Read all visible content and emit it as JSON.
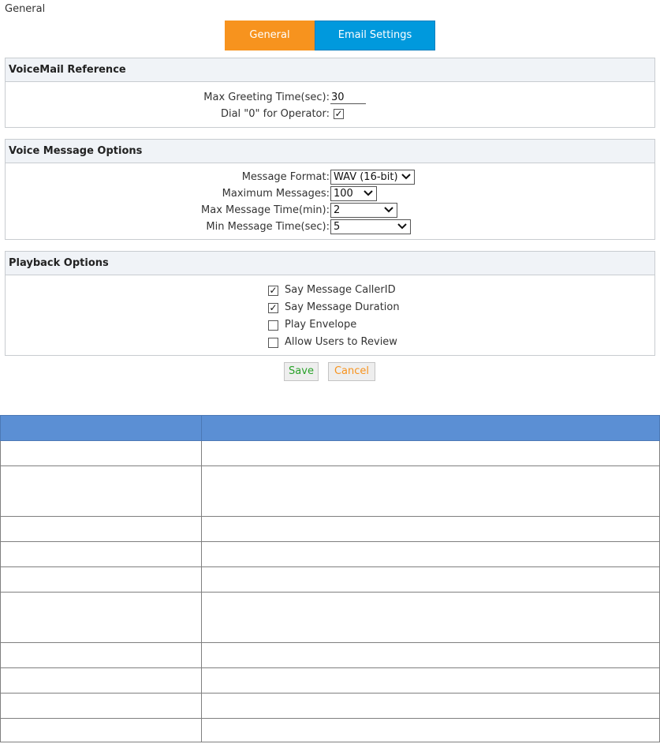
{
  "breadcrumb": "General",
  "tabs": [
    {
      "label": "General",
      "active": true
    },
    {
      "label": "Email Settings",
      "active": false
    }
  ],
  "voicemail_reference": {
    "title": "VoiceMail Reference",
    "max_greeting_label": "Max Greeting Time(sec):",
    "max_greeting_value": "30",
    "dial0_label": "Dial \"0\" for Operator:",
    "dial0_checked": true
  },
  "voice_message_options": {
    "title": "Voice Message Options",
    "message_format_label": "Message Format:",
    "message_format_value": "WAV (16-bit)",
    "max_messages_label": "Maximum Messages:",
    "max_messages_value": "100",
    "max_msg_time_label": "Max Message Time(min):",
    "max_msg_time_value": "2",
    "min_msg_time_label": "Min Message Time(sec):",
    "min_msg_time_value": "5"
  },
  "playback_options": {
    "title": "Playback Options",
    "items": [
      {
        "label": "Say Message CallerID",
        "checked": true
      },
      {
        "label": "Say Message Duration",
        "checked": true
      },
      {
        "label": "Play Envelope",
        "checked": false
      },
      {
        "label": "Allow Users to Review",
        "checked": false
      }
    ]
  },
  "buttons": {
    "save": "Save",
    "cancel": "Cancel"
  },
  "colors": {
    "active_tab": "#f7931e",
    "inactive_tab": "#0099dd",
    "table_header": "#5b8fd4",
    "save_text": "#2aa22a"
  },
  "table": {
    "rows": 10,
    "tall_rows": [
      1,
      5
    ]
  }
}
